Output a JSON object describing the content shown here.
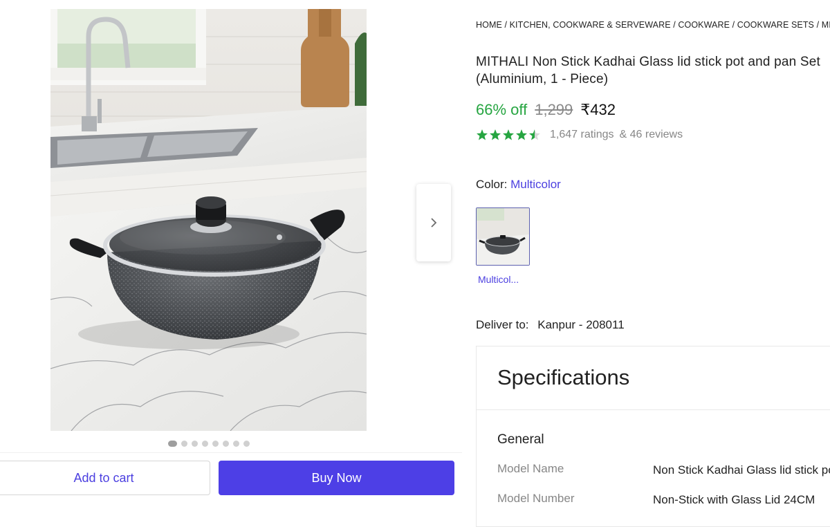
{
  "breadcrumb": {
    "path": "HOME / KITCHEN, COOKWARE & SERVEWARE / COOKWARE / COOKWARE SETS / MIT"
  },
  "product": {
    "title": "MITHALI Non Stick Kadhai Glass lid stick pot and pan Set (Aluminium, 1 - Piece)",
    "discount": "66% off",
    "mrp": "1,299",
    "price": "₹432",
    "rating_value": 4.5,
    "ratings_text": "1,647 ratings",
    "reviews_text": "& 46 reviews",
    "stars_color": "#26a541"
  },
  "gallery": {
    "dot_count": 8,
    "active_index": 0
  },
  "color": {
    "label": "Color:",
    "selected": "Multicolor",
    "swatch_label": "Multicol..."
  },
  "delivery": {
    "label": "Deliver to:",
    "location": "Kanpur - 208011"
  },
  "actions": {
    "add_to_cart": "Add to cart",
    "buy_now": "Buy Now",
    "accent": "#4d3fe6"
  },
  "specifications": {
    "title": "Specifications",
    "group": "General",
    "rows": [
      {
        "key": "Model Name",
        "value": "Non Stick Kadhai Glass lid stick po"
      },
      {
        "key": "Model Number",
        "value": "Non-Stick with Glass Lid 24CM"
      }
    ]
  }
}
